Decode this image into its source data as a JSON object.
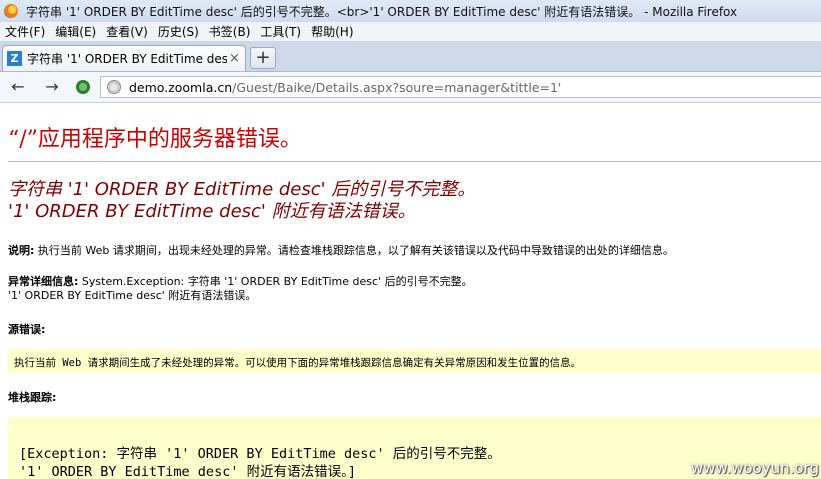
{
  "window": {
    "title": "字符串 '1' ORDER BY EditTime desc' 后的引号不完整。<br>'1' ORDER BY EditTime desc' 附近有语法错误。 - Mozilla Firefox"
  },
  "menu": {
    "items": [
      "文件(F)",
      "编辑(E)",
      "查看(V)",
      "历史(S)",
      "书签(B)",
      "工具(T)",
      "帮助(H)"
    ]
  },
  "tab": {
    "favicon_letter": "Z",
    "label": "字符串 '1' ORDER BY EditTime desc' ...",
    "close": "×",
    "new_tab": "+"
  },
  "nav": {
    "back": "←",
    "forward": "→",
    "url_host": "demo.zoomla.cn",
    "url_path": "/Guest/Baike/Details.aspx?soure=manager&tittle=1'"
  },
  "error_page": {
    "heading": "“/”应用程序中的服务器错误。",
    "message_line1": "字符串 '1' ORDER BY EditTime desc' 后的引号不完整。",
    "message_line2": "'1' ORDER BY EditTime desc' 附近有语法错误。",
    "description_label": "说明:",
    "description_text": "执行当前 Web 请求期间，出现未经处理的异常。请检查堆栈跟踪信息，以了解有关该错误以及代码中导致错误的出处的详细信息。",
    "exception_label": "异常详细信息:",
    "exception_text": "System.Exception: 字符串 '1' ORDER BY EditTime desc' 后的引号不完整。",
    "exception_text2": "'1' ORDER BY EditTime desc' 附近有语法错误。",
    "source_error_label": "源错误:",
    "source_error_text": "执行当前 Web 请求期间生成了未经处理的异常。可以使用下面的异常堆栈跟踪信息确定有关异常原因和发生位置的信息。",
    "stack_trace_label": "堆栈跟踪:",
    "stack_line1": "[Exception: 字符串 '1' ORDER BY EditTime desc' 后的引号不完整。",
    "stack_line2": "'1' ORDER BY EditTime desc' 附近有语法错误。]"
  },
  "watermark": "www.wooyun.org"
}
